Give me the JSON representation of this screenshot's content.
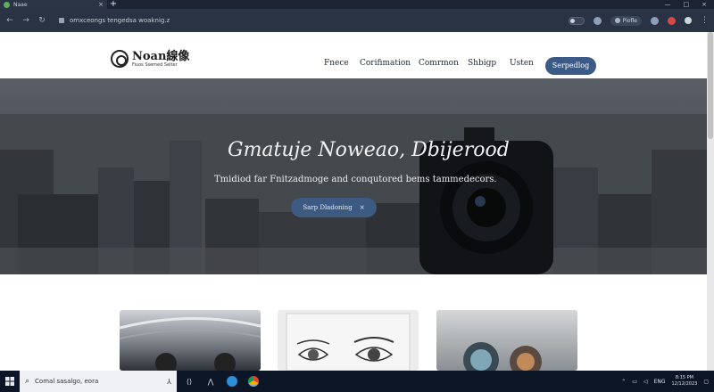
{
  "browser": {
    "tab": {
      "title": "Naae",
      "close": "×"
    },
    "new_tab": "+",
    "window_controls": [
      "—",
      "□",
      "×"
    ],
    "url": "omxceongs tengedsa woaknig.z",
    "profile_label": "Piofle",
    "menu": "⋮"
  },
  "site": {
    "logo": {
      "name": "Noan線像",
      "tagline": "Fiuos Ssemed Selter"
    },
    "nav": [
      "Fnece",
      "Corifimation",
      "Comrmon",
      "Shbigp",
      "Usten"
    ],
    "cta": "Serpedlog"
  },
  "hero": {
    "title": "Gmatuje Noweao, Dbijerood",
    "subtitle": "Tmidiod far Fnitzadmoge and conqutored bems tammedecors.",
    "button": "Sarp Dladoning",
    "button_icon": "×"
  },
  "cards": [
    {
      "name": "card-architecture"
    },
    {
      "name": "card-eye-sketch"
    },
    {
      "name": "card-lens"
    }
  ],
  "taskbar": {
    "search_placeholder": "Comal sasalgo, eora",
    "tray_lang": "ENG",
    "clock_time": "8:15 PM",
    "clock_date": "12/12/2023"
  },
  "colors": {
    "accent": "#3b5a86",
    "browser_chrome": "#2a3344",
    "taskbar": "#0d1626"
  }
}
